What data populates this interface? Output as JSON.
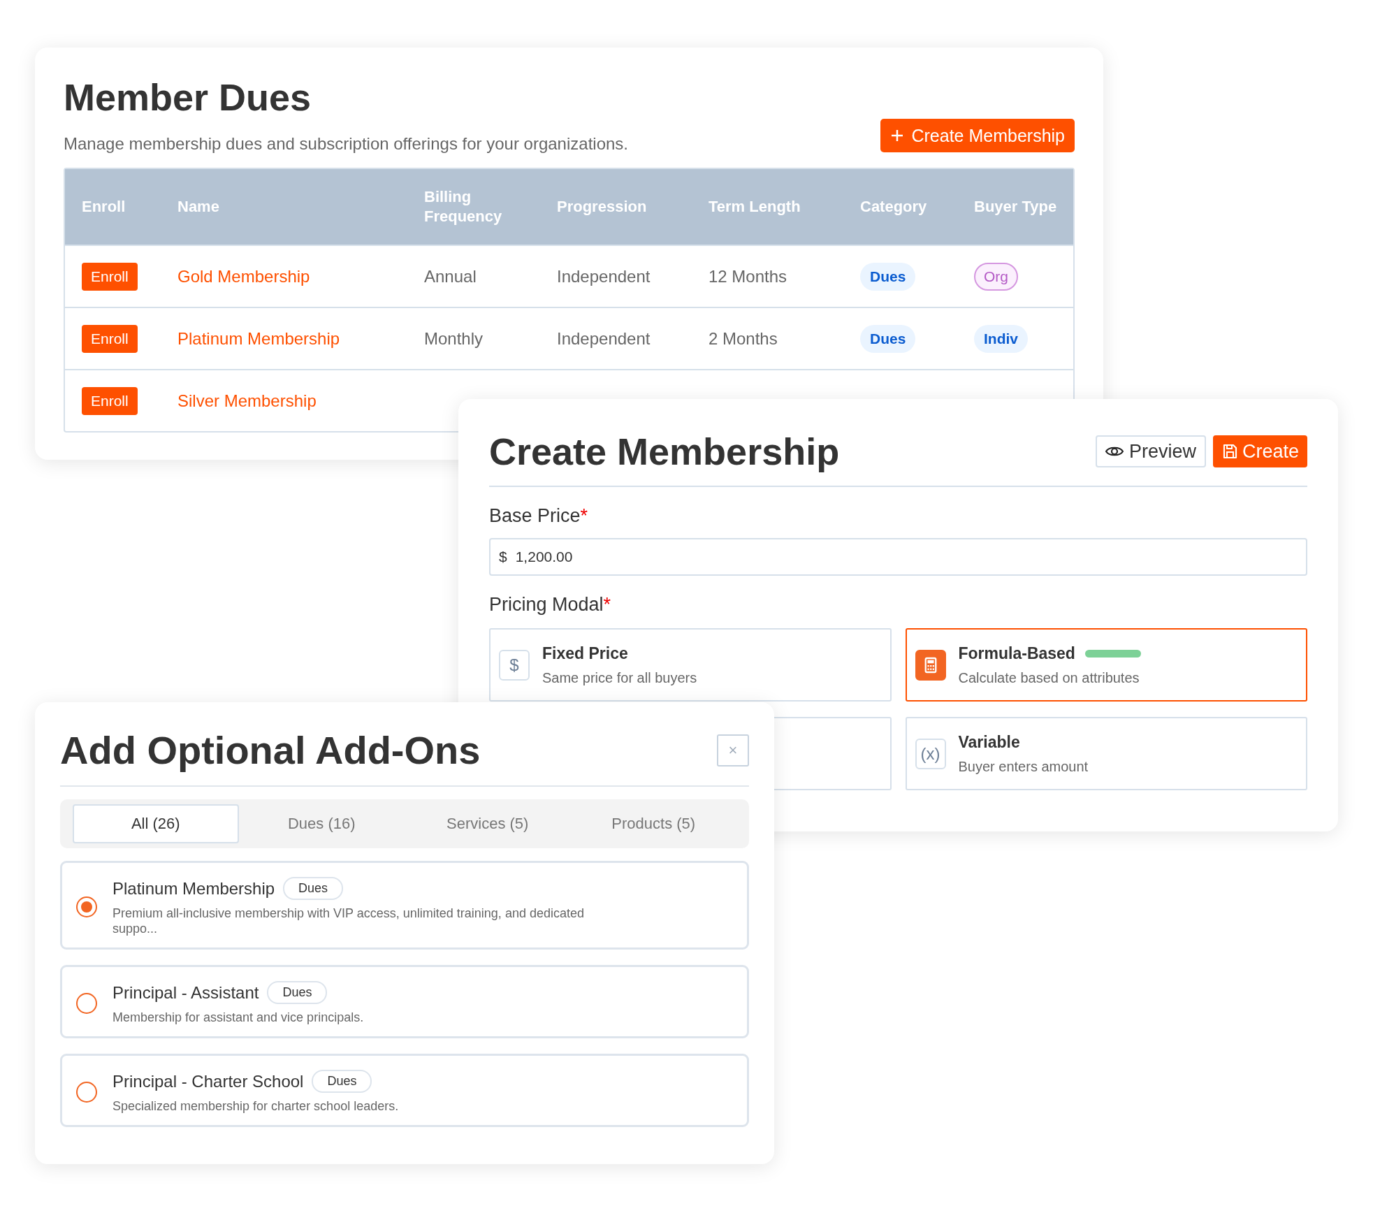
{
  "member_dues": {
    "title": "Member Dues",
    "subtitle": "Manage membership dues and subscription offerings for your organizations.",
    "create_button": "Create Membership",
    "table": {
      "columns": [
        "Enroll",
        "Name",
        "Billing Frequency",
        "Progression",
        "Term Length",
        "Category",
        "Buyer Type"
      ],
      "rows": [
        {
          "enroll": "Enroll",
          "name": "Gold Membership",
          "billing": "Annual",
          "progression": "Independent",
          "term": "12 Months",
          "category": {
            "label": "Dues",
            "kind": "blue"
          },
          "buyer_type": {
            "label": "Org",
            "kind": "purple"
          }
        },
        {
          "enroll": "Enroll",
          "name": "Platinum Membership",
          "billing": "Monthly",
          "progression": "Independent",
          "term": "2 Months",
          "category": {
            "label": "Dues",
            "kind": "blue"
          },
          "buyer_type": {
            "label": "Indiv",
            "kind": "blue"
          }
        },
        {
          "enroll": "Enroll",
          "name": "Silver Membership"
        }
      ]
    }
  },
  "create_membership": {
    "title": "Create Membership",
    "buttons": [
      {
        "label": "Preview",
        "kind": "outline"
      },
      {
        "label": "Create",
        "kind": "primary"
      }
    ],
    "base_price": {
      "label": "Base Price",
      "required_mark": "*",
      "prefix": "$",
      "value": "1,200.00"
    },
    "pricing_modal": {
      "label": "Pricing Modal",
      "required_mark": "*",
      "options": [
        {
          "kind": "glyph",
          "title": "Fixed Price",
          "description": "Same price for all buyers",
          "icon_glyph": "$",
          "selected": false
        },
        {
          "kind": "calculator",
          "title": "Formula-Based",
          "description": "Calculate based on attributes",
          "selected": true
        },
        {
          "kind": "covered",
          "selected": false
        },
        {
          "kind": "glyph",
          "title": "Variable",
          "description": "Buyer enters amount",
          "icon_glyph": "(x)",
          "selected": false
        }
      ]
    }
  },
  "add_ons": {
    "title": "Add Optional Add-Ons",
    "close": "×",
    "tabs": [
      {
        "label": "All (26)",
        "selected": true
      },
      {
        "label": "Dues (16)",
        "selected": false
      },
      {
        "label": "Services (5)",
        "selected": false
      },
      {
        "label": "Products (5)",
        "selected": false
      }
    ],
    "items": [
      {
        "title": "Platinum Membership",
        "tag": "Dues",
        "description": "Premium all-inclusive membership with VIP access, unlimited training, and dedicated suppo...",
        "selected": true
      },
      {
        "title": "Principal - Assistant",
        "tag": "Dues",
        "description": "Membership for assistant and vice principals.",
        "selected": false
      },
      {
        "title": "Principal - Charter School",
        "tag": "Dues",
        "description": "Specialized membership for charter school leaders.",
        "selected": false
      }
    ]
  }
}
